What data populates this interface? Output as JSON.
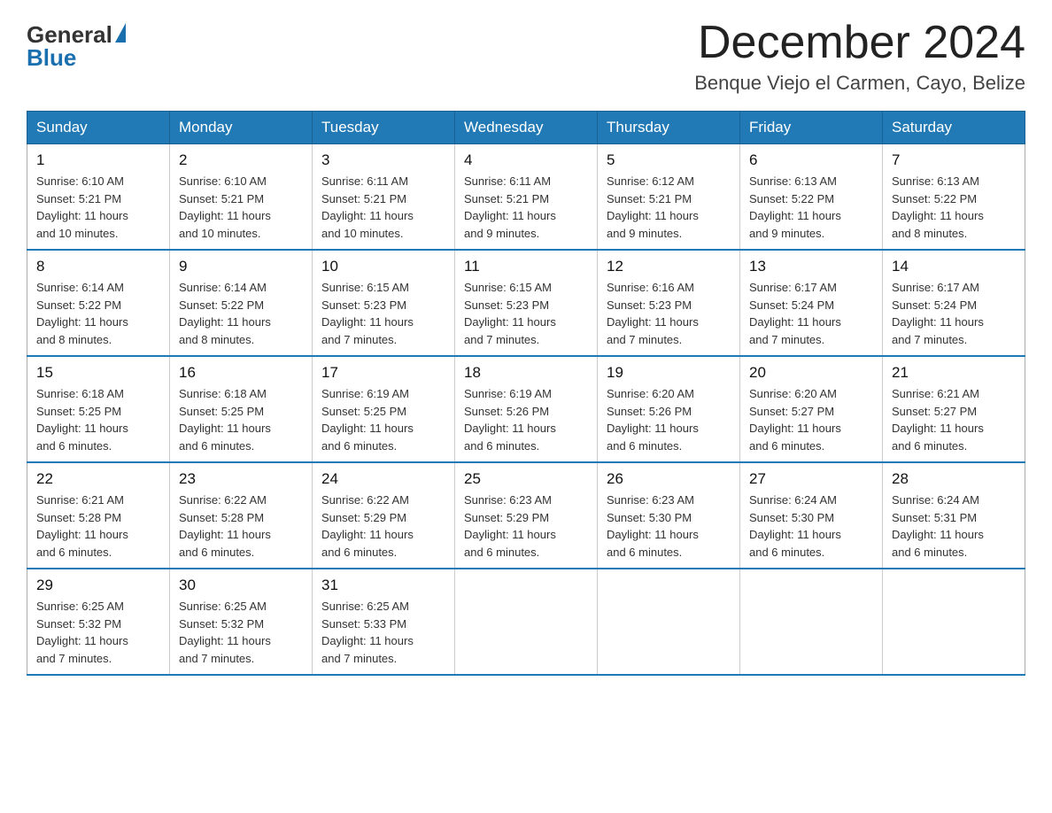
{
  "logo": {
    "general": "General",
    "blue": "Blue"
  },
  "title": "December 2024",
  "location": "Benque Viejo el Carmen, Cayo, Belize",
  "days_of_week": [
    "Sunday",
    "Monday",
    "Tuesday",
    "Wednesday",
    "Thursday",
    "Friday",
    "Saturday"
  ],
  "weeks": [
    [
      {
        "day": "1",
        "sunrise": "6:10 AM",
        "sunset": "5:21 PM",
        "daylight": "11 hours and 10 minutes."
      },
      {
        "day": "2",
        "sunrise": "6:10 AM",
        "sunset": "5:21 PM",
        "daylight": "11 hours and 10 minutes."
      },
      {
        "day": "3",
        "sunrise": "6:11 AM",
        "sunset": "5:21 PM",
        "daylight": "11 hours and 10 minutes."
      },
      {
        "day": "4",
        "sunrise": "6:11 AM",
        "sunset": "5:21 PM",
        "daylight": "11 hours and 9 minutes."
      },
      {
        "day": "5",
        "sunrise": "6:12 AM",
        "sunset": "5:21 PM",
        "daylight": "11 hours and 9 minutes."
      },
      {
        "day": "6",
        "sunrise": "6:13 AM",
        "sunset": "5:22 PM",
        "daylight": "11 hours and 9 minutes."
      },
      {
        "day": "7",
        "sunrise": "6:13 AM",
        "sunset": "5:22 PM",
        "daylight": "11 hours and 8 minutes."
      }
    ],
    [
      {
        "day": "8",
        "sunrise": "6:14 AM",
        "sunset": "5:22 PM",
        "daylight": "11 hours and 8 minutes."
      },
      {
        "day": "9",
        "sunrise": "6:14 AM",
        "sunset": "5:22 PM",
        "daylight": "11 hours and 8 minutes."
      },
      {
        "day": "10",
        "sunrise": "6:15 AM",
        "sunset": "5:23 PM",
        "daylight": "11 hours and 7 minutes."
      },
      {
        "day": "11",
        "sunrise": "6:15 AM",
        "sunset": "5:23 PM",
        "daylight": "11 hours and 7 minutes."
      },
      {
        "day": "12",
        "sunrise": "6:16 AM",
        "sunset": "5:23 PM",
        "daylight": "11 hours and 7 minutes."
      },
      {
        "day": "13",
        "sunrise": "6:17 AM",
        "sunset": "5:24 PM",
        "daylight": "11 hours and 7 minutes."
      },
      {
        "day": "14",
        "sunrise": "6:17 AM",
        "sunset": "5:24 PM",
        "daylight": "11 hours and 7 minutes."
      }
    ],
    [
      {
        "day": "15",
        "sunrise": "6:18 AM",
        "sunset": "5:25 PM",
        "daylight": "11 hours and 6 minutes."
      },
      {
        "day": "16",
        "sunrise": "6:18 AM",
        "sunset": "5:25 PM",
        "daylight": "11 hours and 6 minutes."
      },
      {
        "day": "17",
        "sunrise": "6:19 AM",
        "sunset": "5:25 PM",
        "daylight": "11 hours and 6 minutes."
      },
      {
        "day": "18",
        "sunrise": "6:19 AM",
        "sunset": "5:26 PM",
        "daylight": "11 hours and 6 minutes."
      },
      {
        "day": "19",
        "sunrise": "6:20 AM",
        "sunset": "5:26 PM",
        "daylight": "11 hours and 6 minutes."
      },
      {
        "day": "20",
        "sunrise": "6:20 AM",
        "sunset": "5:27 PM",
        "daylight": "11 hours and 6 minutes."
      },
      {
        "day": "21",
        "sunrise": "6:21 AM",
        "sunset": "5:27 PM",
        "daylight": "11 hours and 6 minutes."
      }
    ],
    [
      {
        "day": "22",
        "sunrise": "6:21 AM",
        "sunset": "5:28 PM",
        "daylight": "11 hours and 6 minutes."
      },
      {
        "day": "23",
        "sunrise": "6:22 AM",
        "sunset": "5:28 PM",
        "daylight": "11 hours and 6 minutes."
      },
      {
        "day": "24",
        "sunrise": "6:22 AM",
        "sunset": "5:29 PM",
        "daylight": "11 hours and 6 minutes."
      },
      {
        "day": "25",
        "sunrise": "6:23 AM",
        "sunset": "5:29 PM",
        "daylight": "11 hours and 6 minutes."
      },
      {
        "day": "26",
        "sunrise": "6:23 AM",
        "sunset": "5:30 PM",
        "daylight": "11 hours and 6 minutes."
      },
      {
        "day": "27",
        "sunrise": "6:24 AM",
        "sunset": "5:30 PM",
        "daylight": "11 hours and 6 minutes."
      },
      {
        "day": "28",
        "sunrise": "6:24 AM",
        "sunset": "5:31 PM",
        "daylight": "11 hours and 6 minutes."
      }
    ],
    [
      {
        "day": "29",
        "sunrise": "6:25 AM",
        "sunset": "5:32 PM",
        "daylight": "11 hours and 7 minutes."
      },
      {
        "day": "30",
        "sunrise": "6:25 AM",
        "sunset": "5:32 PM",
        "daylight": "11 hours and 7 minutes."
      },
      {
        "day": "31",
        "sunrise": "6:25 AM",
        "sunset": "5:33 PM",
        "daylight": "11 hours and 7 minutes."
      },
      null,
      null,
      null,
      null
    ]
  ],
  "sunrise_label": "Sunrise:",
  "sunset_label": "Sunset:",
  "daylight_label": "Daylight:"
}
